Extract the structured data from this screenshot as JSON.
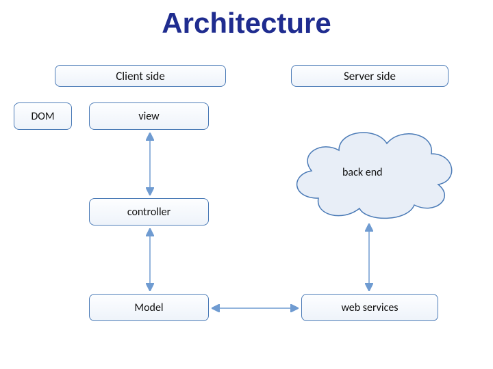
{
  "title": "Architecture",
  "labels": {
    "client_side": "Client side",
    "server_side": "Server side",
    "dom": "DOM",
    "view": "view",
    "controller": "controller",
    "model": "Model",
    "back_end": "back end",
    "web_services": "web services"
  }
}
